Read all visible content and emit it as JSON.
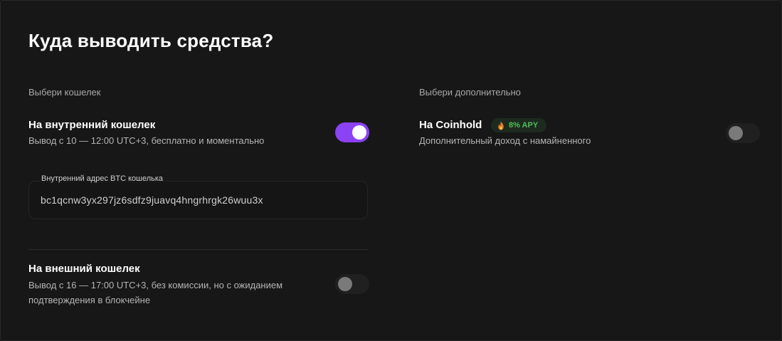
{
  "title": "Куда выводить средства?",
  "left": {
    "section_label": "Выбери кошелек",
    "internal": {
      "title": "На внутренний кошелек",
      "description": "Вывод с 10 — 12:00 UTC+3, бесплатно и моментально",
      "enabled": true
    },
    "address": {
      "label": "Внутренний адрес BTC кошелька",
      "value": "bc1qcnw3yx297jz6sdfz9juavq4hngrhrgk26wuu3x"
    },
    "external": {
      "title": "На внешний кошелек",
      "description_line1": "Вывод с 16 — 17:00 UTC+3, без комиссии, но с ожиданием",
      "description_line2": "подтверждения в блокчейне",
      "enabled": false
    }
  },
  "right": {
    "section_label": "Выбери дополнительно",
    "coinhold": {
      "title": "На Coinhold",
      "badge": "8% APY",
      "badge_icon": "flame-icon",
      "description": "Дополнительный доход с намайненного",
      "enabled": false
    }
  },
  "colors": {
    "accent": "#8b42f5",
    "badge_text": "#4fc05a",
    "badge_bg": "#1d2a1f",
    "background": "#171717"
  }
}
